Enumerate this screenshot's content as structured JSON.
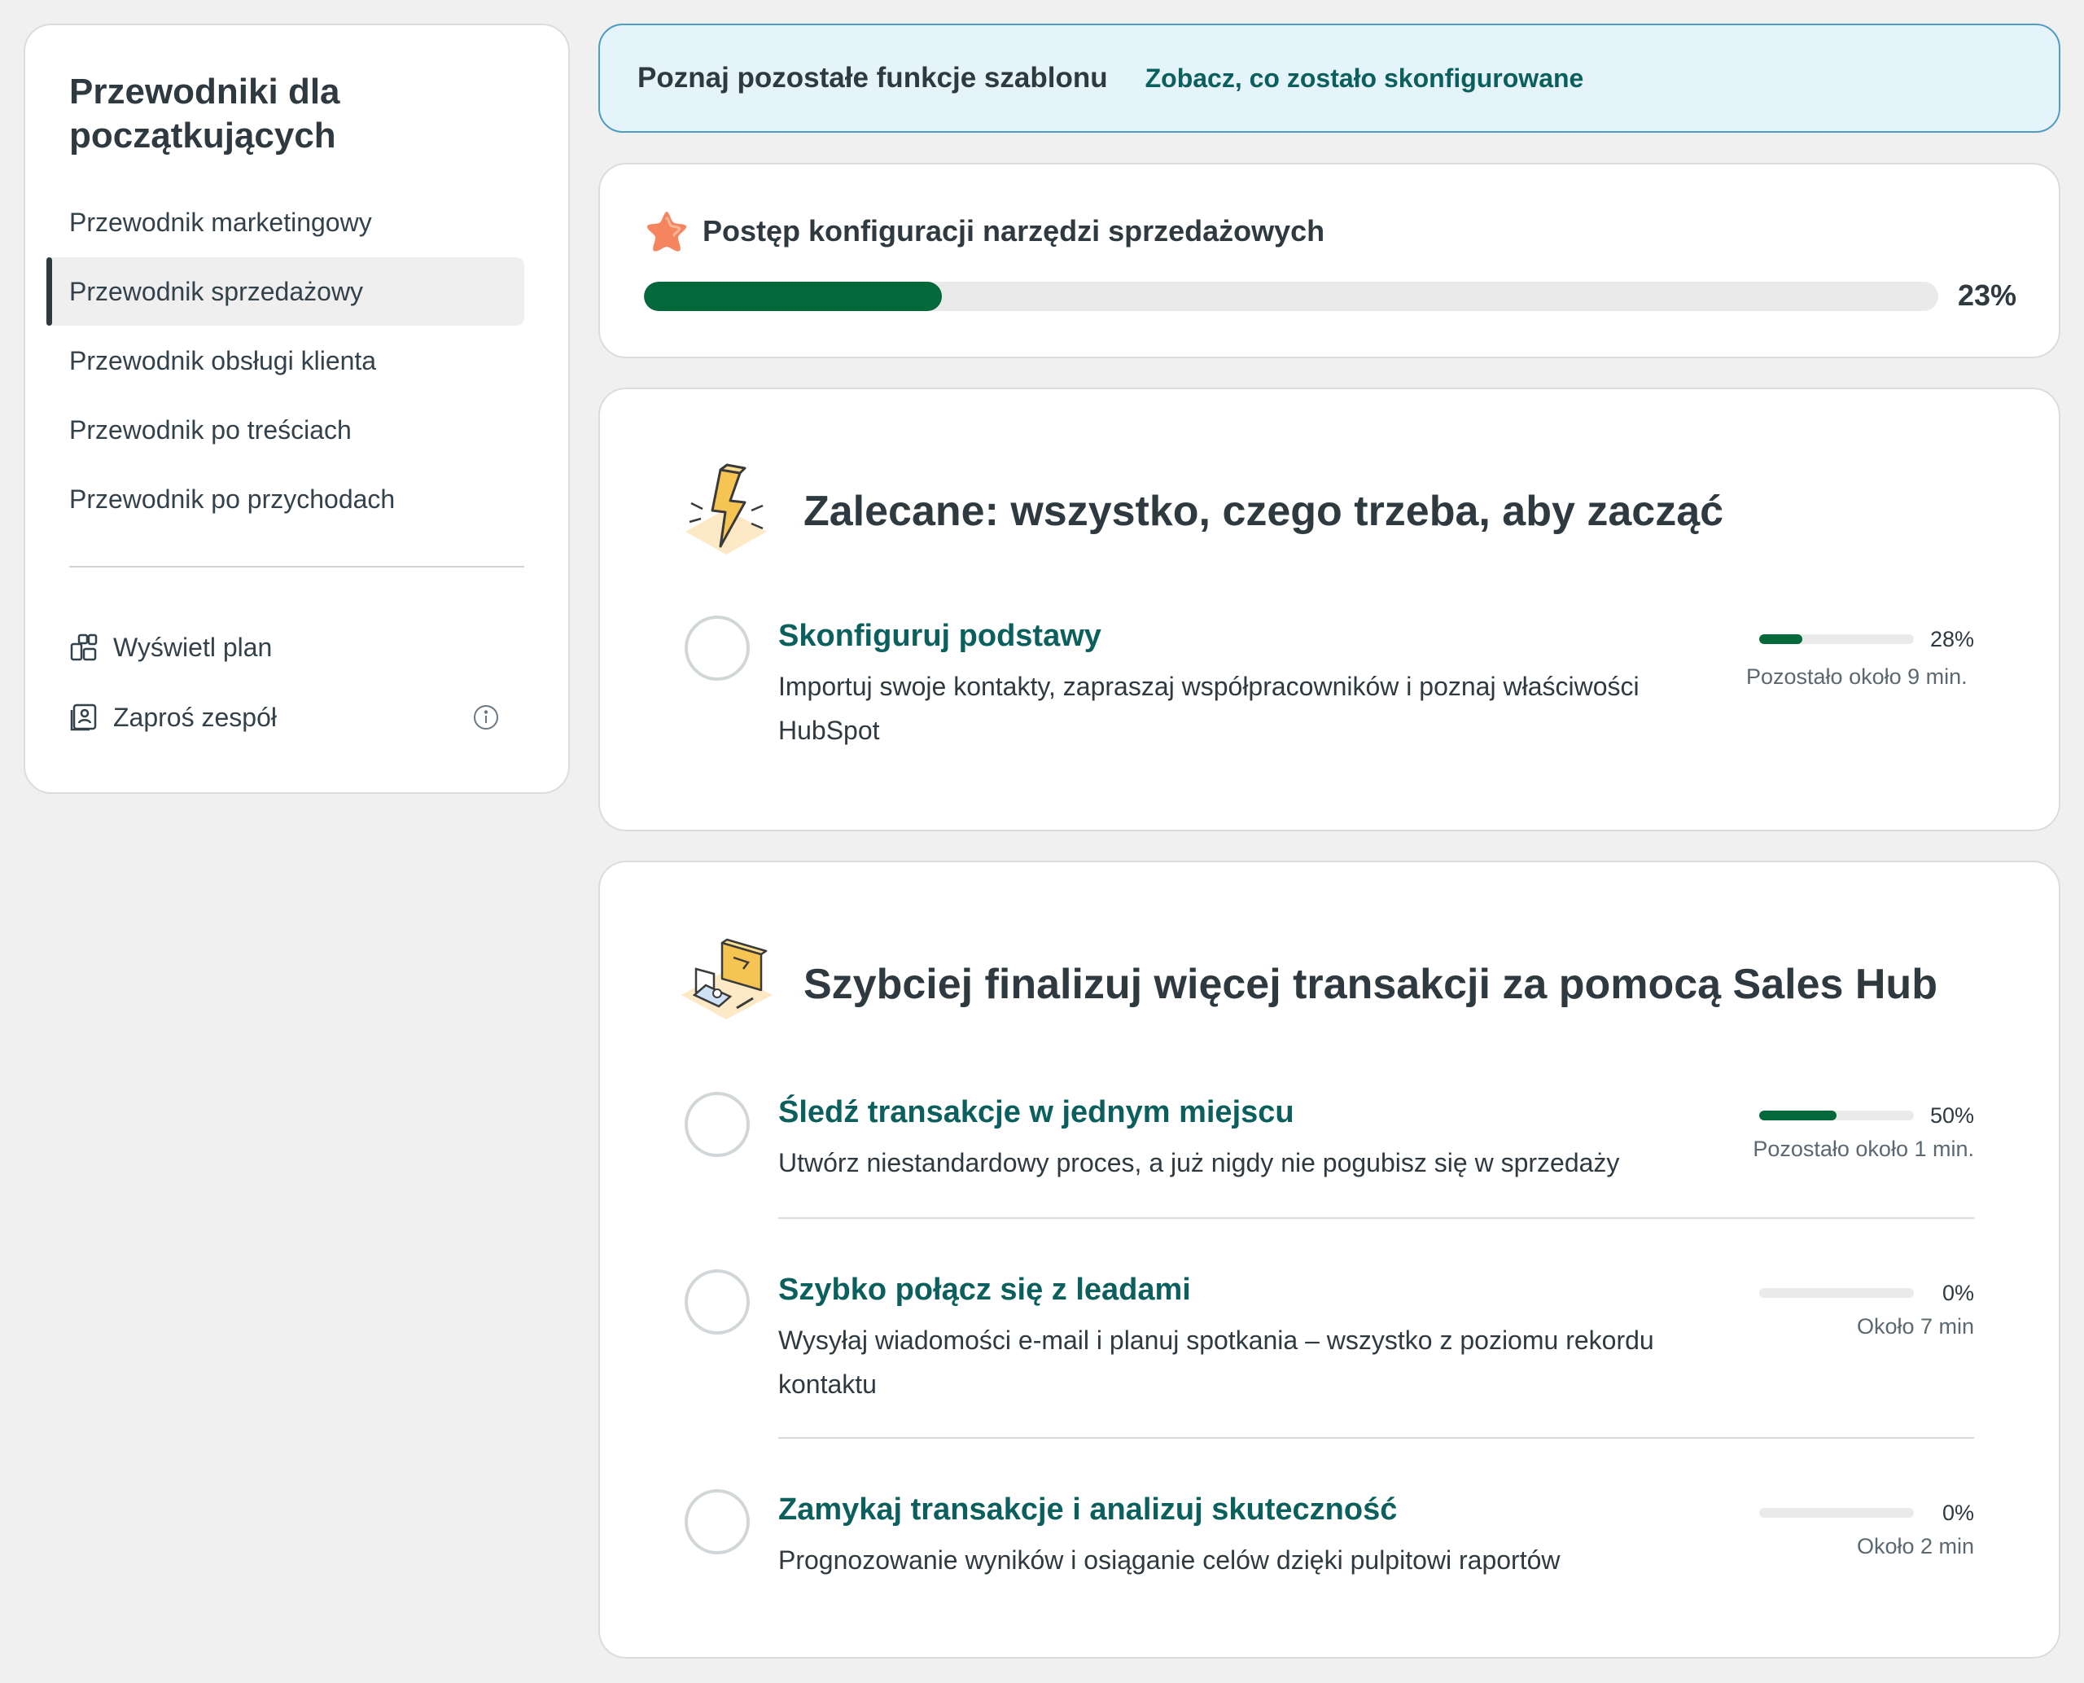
{
  "sidebar": {
    "title": "Przewodniki dla początkujących",
    "items": [
      {
        "label": "Przewodnik marketingowy"
      },
      {
        "label": "Przewodnik sprzedażowy"
      },
      {
        "label": "Przewodnik obsługi klienta"
      },
      {
        "label": "Przewodnik po treściach"
      },
      {
        "label": "Przewodnik po przychodach"
      }
    ],
    "active_index": 1,
    "view_plan_label": "Wyświetl plan",
    "invite_team_label": "Zaproś zespół"
  },
  "banner": {
    "text": "Poznaj pozostałe funkcje szablonu",
    "link": "Zobacz, co zostało skonfigurowane"
  },
  "progress": {
    "title": "Postęp konfiguracji narzędzi sprzedażowych",
    "percent_label": "23%",
    "percent": 23
  },
  "sections": [
    {
      "title": "Zalecane: wszystko, czego trzeba, aby zacząć",
      "tasks": [
        {
          "title": "Skonfiguruj podstawy",
          "description": "Importuj swoje kontakty, zapraszaj współpracowników i poznaj właściwości HubSpot",
          "percent_label": "28%",
          "percent": 28,
          "time": "Pozostało około 9 min."
        }
      ]
    },
    {
      "title": "Szybciej finalizuj więcej transakcji za pomocą Sales Hub",
      "tasks": [
        {
          "title": "Śledź transakcje w jednym miejscu",
          "description": "Utwórz niestandardowy proces, a już nigdy nie pogubisz się w sprzedaży",
          "percent_label": "50%",
          "percent": 50,
          "time": "Pozostało około 1 min."
        },
        {
          "title": "Szybko połącz się z leadami",
          "description": "Wysyłaj wiadomości e-mail i planuj spotkania – wszystko z poziomu rekordu kontaktu",
          "percent_label": "0%",
          "percent": 0,
          "time": "Około 7 min"
        },
        {
          "title": "Zamykaj transakcje i analizuj skuteczność",
          "description": "Prognozowanie wyników i osiąganie celów dzięki pulpitowi raportów",
          "percent_label": "0%",
          "percent": 0,
          "time": "Około 2 min"
        }
      ]
    }
  ],
  "colors": {
    "accent_green": "#03693a",
    "link_teal": "#0b5f5c",
    "banner_bg": "#e5f3fa",
    "banner_border": "#4f9ec2"
  }
}
